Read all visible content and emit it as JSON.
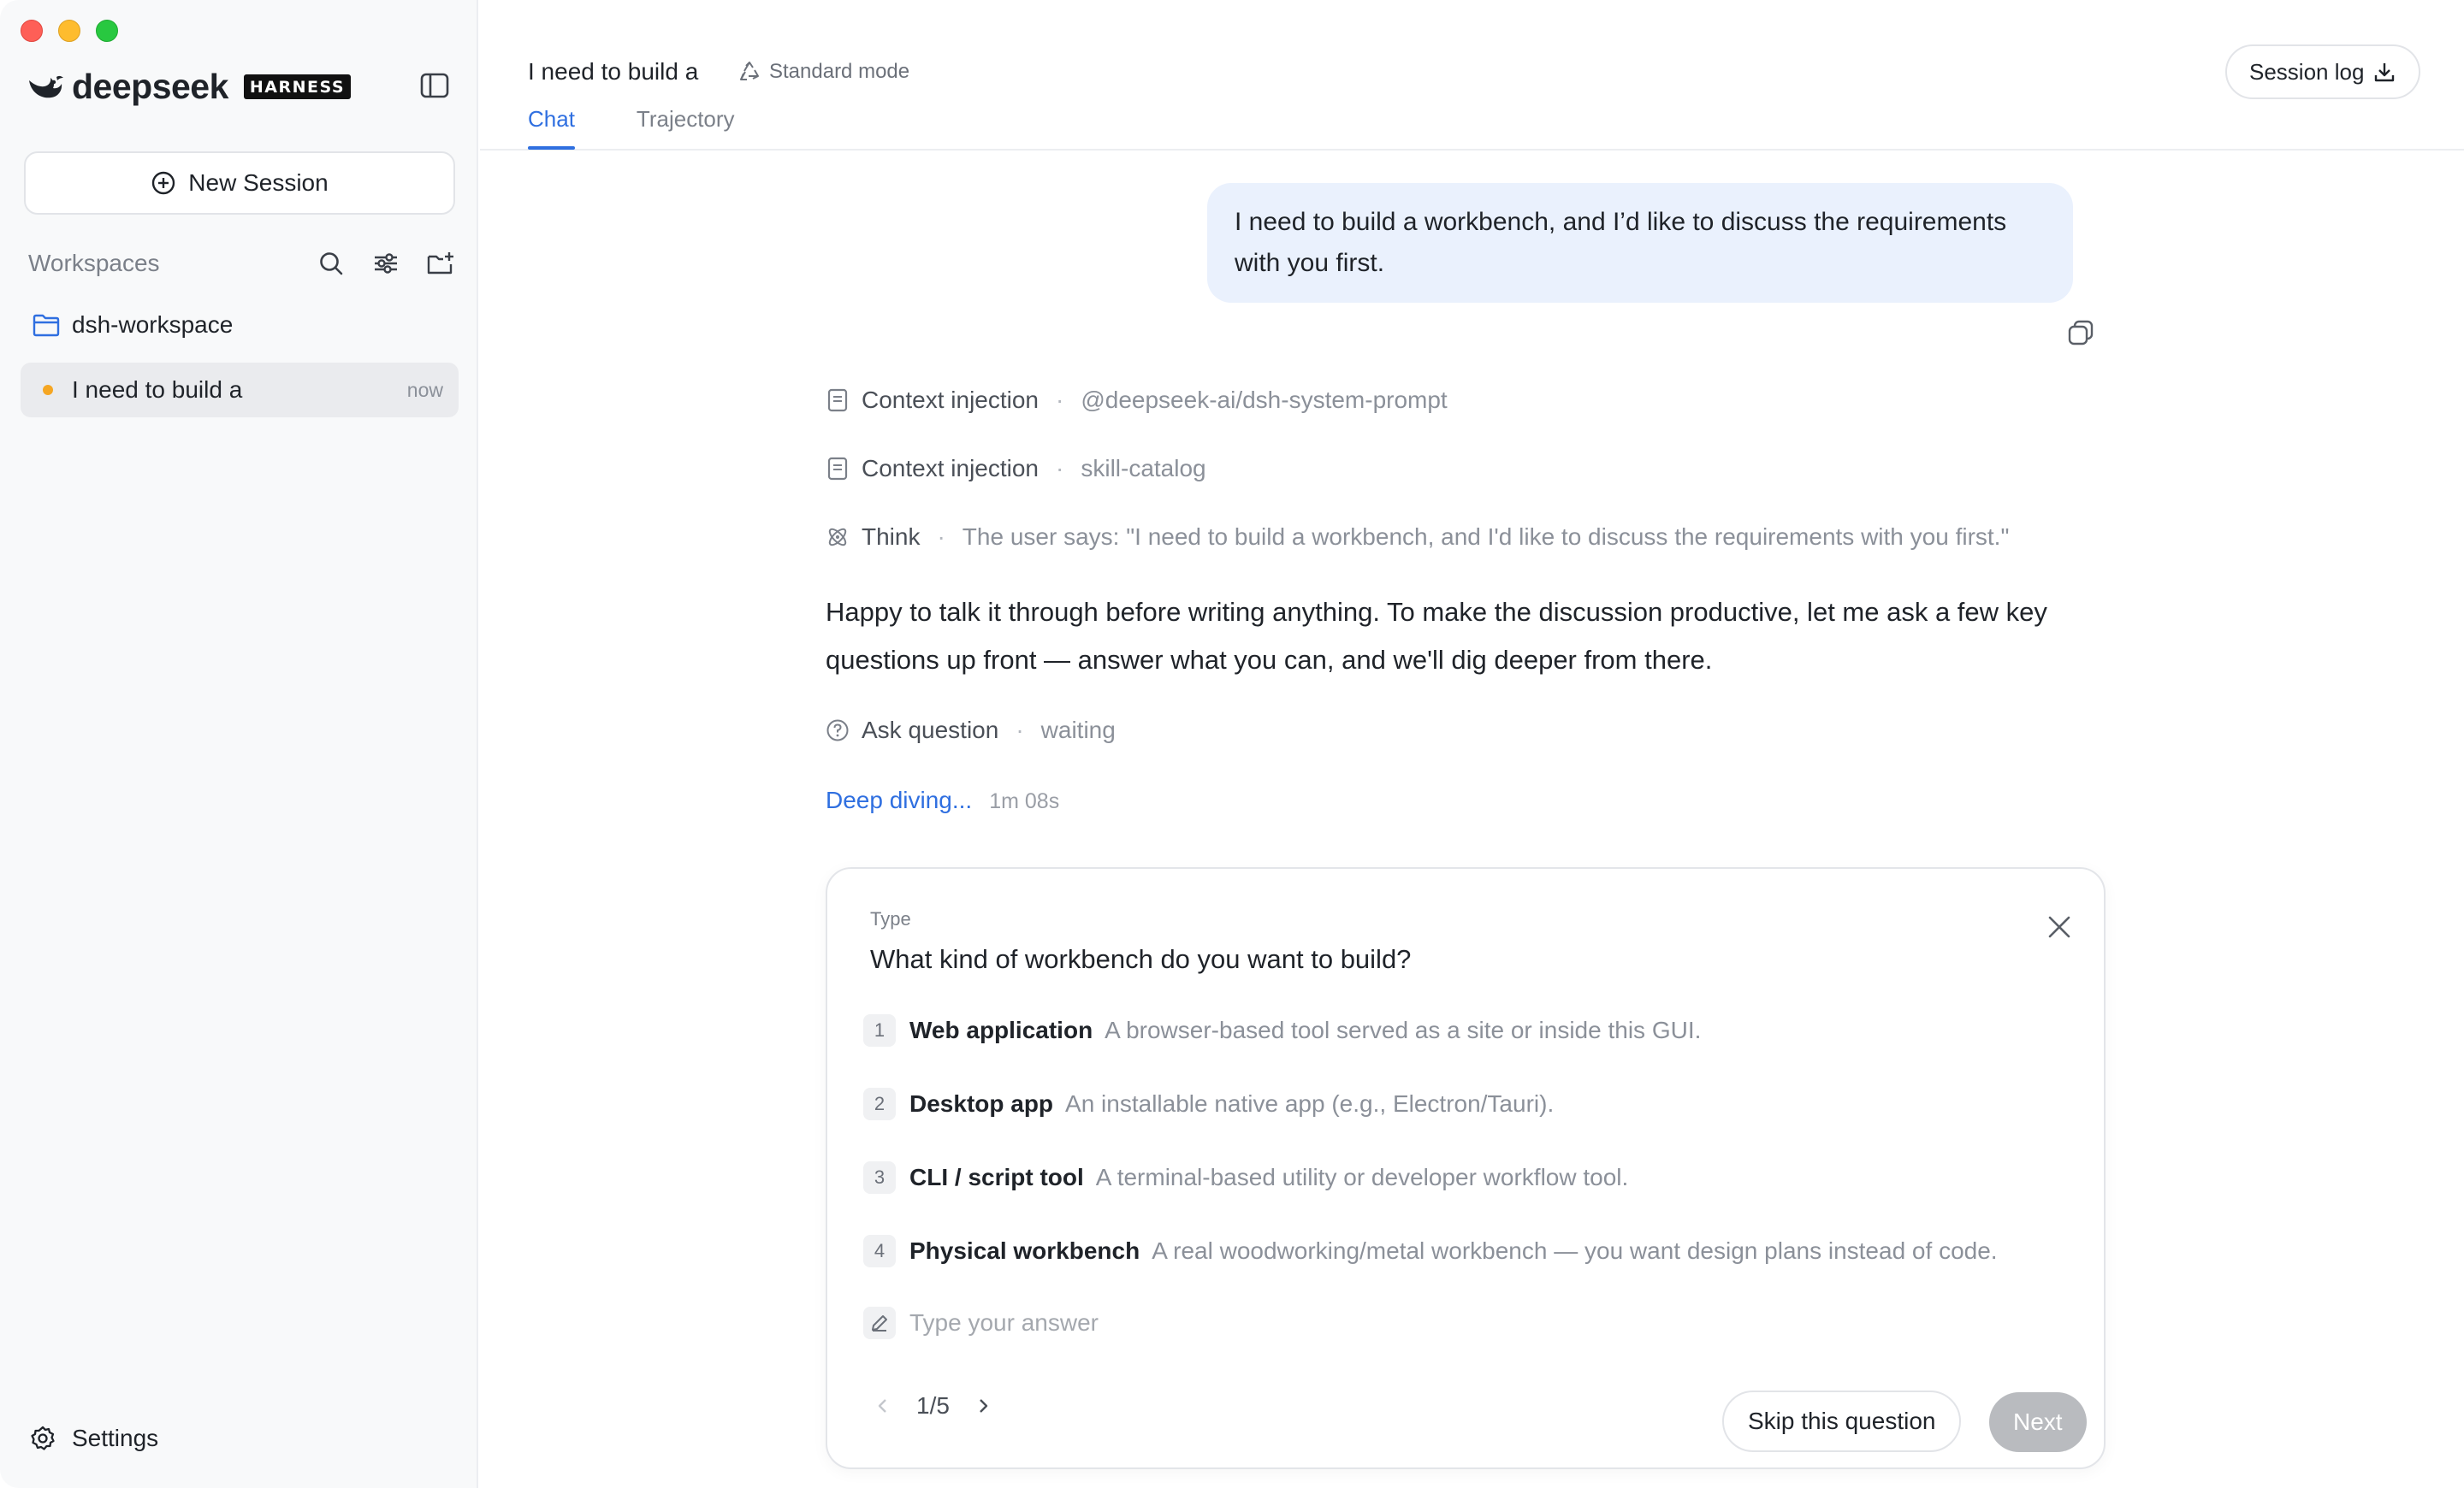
{
  "colors": {
    "accent": "#2f6fe0",
    "user_bubble": "#eaf1fd",
    "sidebar_bg": "#f8f9fa",
    "session_dot": "#f5a623",
    "next_disabled": "#b9bbbf"
  },
  "sidebar": {
    "brand_name": "deepseek",
    "brand_tag": "HARNESS",
    "new_session_label": "New Session",
    "workspaces_title": "Workspaces",
    "workspace_folder": "dsh-workspace",
    "sessions": [
      {
        "label": "I need to build a",
        "time": "now"
      }
    ],
    "settings_label": "Settings"
  },
  "header": {
    "session_title": "I need to build a",
    "mode_label": "Standard mode",
    "session_log_label": "Session log",
    "tabs": [
      {
        "label": "Chat"
      },
      {
        "label": "Trajectory"
      }
    ]
  },
  "chat": {
    "user_message": "I need to build a workbench, and I’d like to discuss the requirements with you first.",
    "steps": [
      {
        "icon": "document-icon",
        "label": "Context injection",
        "detail": "@deepseek-ai/dsh-system-prompt"
      },
      {
        "icon": "document-icon",
        "label": "Context injection",
        "detail": "skill-catalog"
      },
      {
        "icon": "atom-icon",
        "label": "Think",
        "detail": "The user says: \"I need to build a workbench, and I'd like to discuss the requirements with you first.\""
      },
      {
        "icon": "question-icon",
        "label": "Ask question",
        "detail": "waiting"
      }
    ],
    "assistant_message": "Happy to talk it through before writing anything. To make the discussion productive, let me ask a few key questions up front — answer what you can, and we'll dig deeper from there.",
    "status_label": "Deep diving...",
    "status_time": "1m 08s"
  },
  "question": {
    "type_label": "Type",
    "text": "What kind of workbench do you want to build?",
    "options": [
      {
        "num": "1",
        "title": "Web application",
        "desc": "A browser-based tool served as a site or inside this GUI."
      },
      {
        "num": "2",
        "title": "Desktop app",
        "desc": "An installable native app (e.g., Electron/Tauri)."
      },
      {
        "num": "3",
        "title": "CLI / script tool",
        "desc": "A terminal-based utility or developer workflow tool."
      },
      {
        "num": "4",
        "title": "Physical workbench",
        "desc": "A real woodworking/metal workbench — you want design plans instead of code."
      }
    ],
    "answer_placeholder": "Type your answer",
    "pager": "1/5",
    "skip_label": "Skip this question",
    "next_label": "Next"
  }
}
